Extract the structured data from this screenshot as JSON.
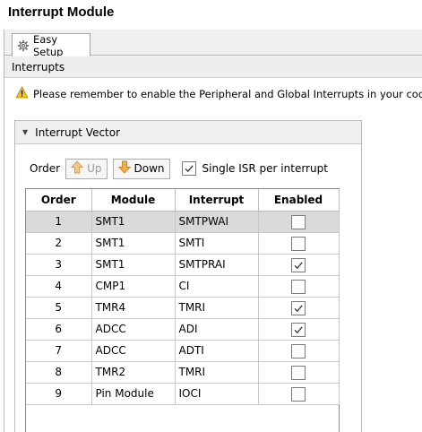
{
  "header": {
    "title": "Interrupt Module"
  },
  "tabs": [
    {
      "label": "Easy Setup",
      "icon": "gear-icon"
    }
  ],
  "section": {
    "title": "Interrupts"
  },
  "warning": {
    "text": "Please remember to enable the Peripheral and Global Interrupts in your code!",
    "icon": "warning-icon"
  },
  "vector": {
    "title": "Interrupt Vector",
    "order_label": "Order",
    "up_label": "Up",
    "down_label": "Down",
    "single_isr_label": "Single ISR per interrupt",
    "single_isr_checked": true
  },
  "table": {
    "columns": [
      "Order",
      "Module",
      "Interrupt",
      "Enabled"
    ],
    "rows": [
      {
        "order": "1",
        "module": "SMT1",
        "interrupt": "SMTPWAI",
        "enabled": false
      },
      {
        "order": "2",
        "module": "SMT1",
        "interrupt": "SMTI",
        "enabled": false
      },
      {
        "order": "3",
        "module": "SMT1",
        "interrupt": "SMTPRAI",
        "enabled": true
      },
      {
        "order": "4",
        "module": "CMP1",
        "interrupt": "CI",
        "enabled": false
      },
      {
        "order": "5",
        "module": "TMR4",
        "interrupt": "TMRI",
        "enabled": true
      },
      {
        "order": "6",
        "module": "ADCC",
        "interrupt": "ADI",
        "enabled": true
      },
      {
        "order": "7",
        "module": "ADCC",
        "interrupt": "ADTI",
        "enabled": false
      },
      {
        "order": "8",
        "module": "TMR2",
        "interrupt": "TMRI",
        "enabled": false
      },
      {
        "order": "9",
        "module": "Pin Module",
        "interrupt": "IOCI",
        "enabled": false
      }
    ]
  },
  "colors": {
    "arrow": "#e8a23a",
    "selected_row": "#d9d9d9",
    "warning": "#f5c518"
  }
}
